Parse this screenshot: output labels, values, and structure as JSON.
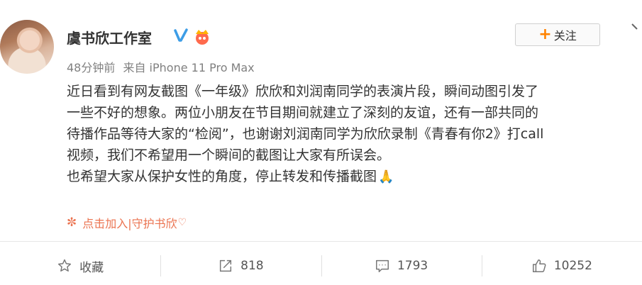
{
  "post": {
    "author": "虞书欣工作室",
    "meta": {
      "time": "48分钟前",
      "source": "来自 iPhone 11 Pro Max"
    },
    "follow_label": "关注",
    "lines": [
      "近日看到有网友截图《一年级》欣欣和刘润南同学的表演片段，瞬间动图引发了",
      "一些不好的想象。两位小朋友在节目期间就建立了深刻的友谊，还有一部共同的",
      "待播作品等待大家的“检阅”，也谢谢刘润南同学为欣欣录制《青春有你2》打call",
      "视频，我们不希望用一个瞬间的截图让大家有所误会。",
      "也希望大家从保护女性的角度，停止转发和传播截图"
    ],
    "emoji": "🙏",
    "join_link": "点击加入|守护书欣",
    "join_suffix": "♡"
  },
  "actions": {
    "favorite_label": "收藏",
    "repost_count": "818",
    "comment_count": "1793",
    "like_count": "10252"
  },
  "colors": {
    "accent": "#ff8200",
    "link": "#eb7350",
    "verified": "#3d9de6"
  },
  "icons": [
    "avatar",
    "verified-icon",
    "crown-badge-icon",
    "chevron-down-icon",
    "flower-icon",
    "star-icon",
    "repost-icon",
    "comment-icon",
    "like-icon"
  ]
}
